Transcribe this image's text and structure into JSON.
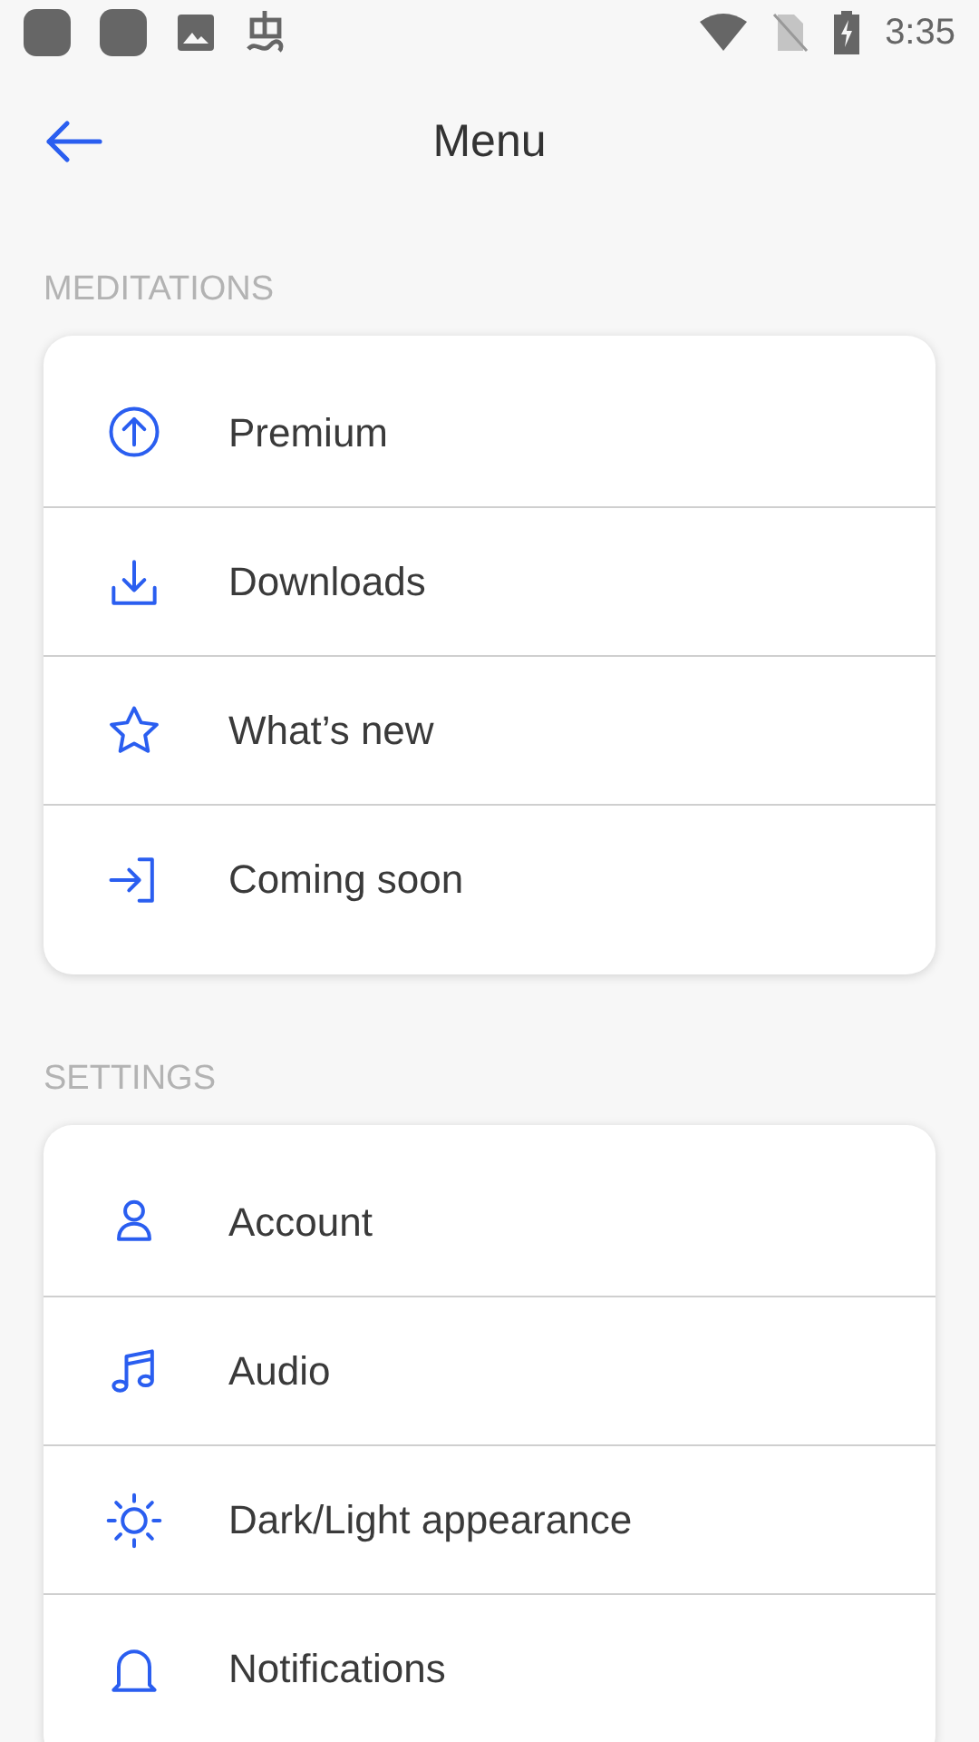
{
  "status_bar": {
    "time": "3:35"
  },
  "header": {
    "title": "Menu"
  },
  "sections": [
    {
      "heading": "MEDITATIONS",
      "items": [
        {
          "label": "Premium"
        },
        {
          "label": "Downloads"
        },
        {
          "label": "What’s new"
        },
        {
          "label": "Coming soon"
        }
      ]
    },
    {
      "heading": "SETTINGS",
      "items": [
        {
          "label": "Account"
        },
        {
          "label": "Audio"
        },
        {
          "label": "Dark/Light appearance"
        },
        {
          "label": "Notifications"
        }
      ]
    }
  ]
}
